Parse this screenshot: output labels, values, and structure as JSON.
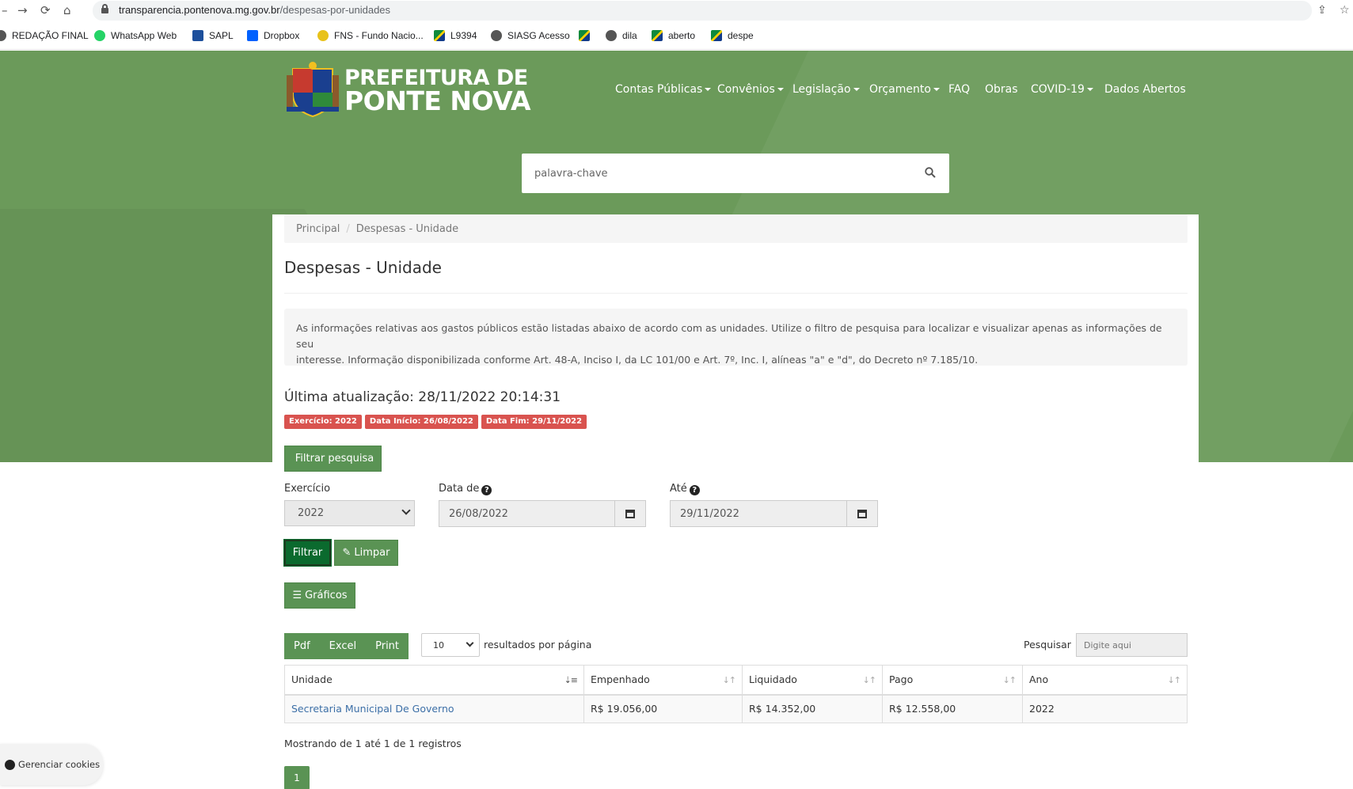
{
  "browser": {
    "url_domain": "transparencia.pontenova.mg.gov.br",
    "url_path": "/despesas-por-unidades",
    "bookmarks": [
      "REDAÇÃO FINAL",
      "WhatsApp Web",
      "SAPL",
      "Dropbox",
      "FNS - Fundo Nacio...",
      "L9394",
      "SIASG Acesso",
      "dila",
      "aberto",
      "despe"
    ]
  },
  "header": {
    "logo_line1": "PREFEITURA DE",
    "logo_line2": "PONTE NOVA",
    "nav": [
      "Contas Públicas",
      "Convênios",
      "Legislação",
      "Orçamento",
      "FAQ",
      "Obras",
      "COVID-19",
      "Dados Abertos"
    ],
    "search_placeholder": "palavra-chave"
  },
  "breadcrumb": [
    "Principal",
    "Despesas - Unidade"
  ],
  "page": {
    "title": "Despesas - Unidade",
    "info_line1": "As informações relativas aos gastos públicos estão listadas abaixo de acordo com as unidades. Utilize o filtro de pesquisa para localizar e visualizar apenas as informações de seu",
    "info_line2": "interesse. Informação disponibilizada conforme Art. 48-A, Inciso I, da LC 101/00 e Art. 7º, Inc. I, alíneas \"a\" e \"d\", do Decreto nº 7.185/10.",
    "updated": "Última atualização: 28/11/2022 20:14:31",
    "labels": [
      "Exercício: 2022",
      "Data Início: 26/08/2022",
      "Data Fim: 29/11/2022"
    ]
  },
  "filters": {
    "toggle_label": "Filtrar pesquisa",
    "exercicio_label": "Exercício",
    "exercicio_value": "2022",
    "data_de_label": "Data de",
    "data_de_value": "26/08/2022",
    "ate_label": "Até",
    "ate_value": "29/11/2022",
    "filtrar_label": "Filtrar",
    "limpar_label": "Limpar",
    "graficos_label": "Gráficos"
  },
  "table_controls": {
    "export": [
      "Pdf",
      "Excel",
      "Print"
    ],
    "per_page_value": "10",
    "per_page_label": "resultados por página",
    "search_label": "Pesquisar",
    "search_placeholder": "Digite aqui"
  },
  "table": {
    "columns": [
      "Unidade",
      "Empenhado",
      "Liquidado",
      "Pago",
      "Ano"
    ],
    "rows": [
      [
        "Secretaria Municipal De Governo",
        "R$ 19.056,00",
        "R$ 14.352,00",
        "R$ 12.558,00",
        "2022"
      ]
    ]
  },
  "pagination": {
    "summary": "Mostrando de 1 até 1 de 1 registros",
    "current_page": "1"
  },
  "cookies_label": "Gerenciar cookies",
  "colors": {
    "hero_green": "#6b9a5a",
    "button_green": "#5a9354",
    "label_red": "#d9534f",
    "link_blue": "#3c6fa7"
  }
}
